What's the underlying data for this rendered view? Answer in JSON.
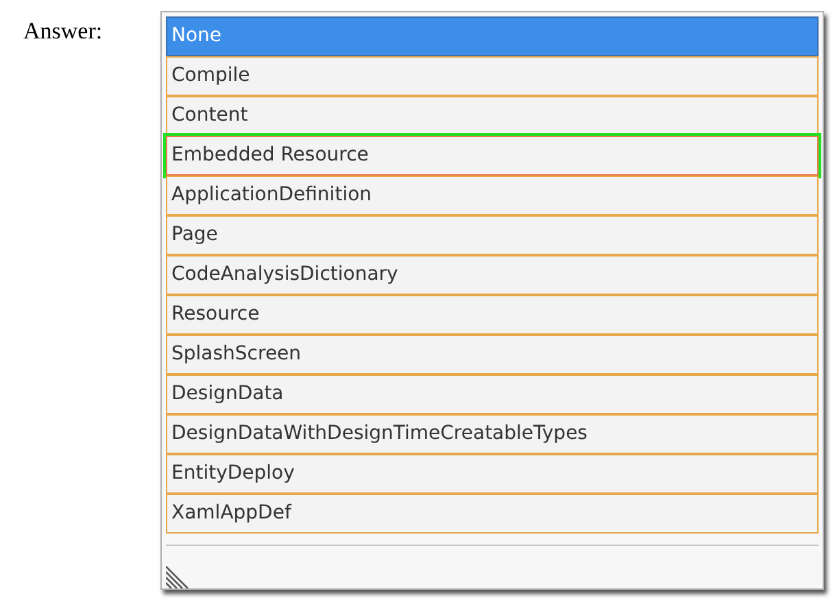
{
  "label": "Answer:",
  "list": {
    "items": [
      {
        "label": "None",
        "selected": true,
        "marked": false
      },
      {
        "label": "Compile",
        "selected": false,
        "marked": false
      },
      {
        "label": "Content",
        "selected": false,
        "marked": false
      },
      {
        "label": "Embedded Resource",
        "selected": false,
        "marked": true
      },
      {
        "label": "ApplicationDefinition",
        "selected": false,
        "marked": false
      },
      {
        "label": "Page",
        "selected": false,
        "marked": false
      },
      {
        "label": "CodeAnalysisDictionary",
        "selected": false,
        "marked": false
      },
      {
        "label": "Resource",
        "selected": false,
        "marked": false
      },
      {
        "label": "SplashScreen",
        "selected": false,
        "marked": false
      },
      {
        "label": "DesignData",
        "selected": false,
        "marked": false
      },
      {
        "label": "DesignDataWithDesignTimeCreatableTypes",
        "selected": false,
        "marked": false
      },
      {
        "label": "EntityDeploy",
        "selected": false,
        "marked": false
      },
      {
        "label": "XamlAppDef",
        "selected": false,
        "marked": false
      }
    ]
  }
}
